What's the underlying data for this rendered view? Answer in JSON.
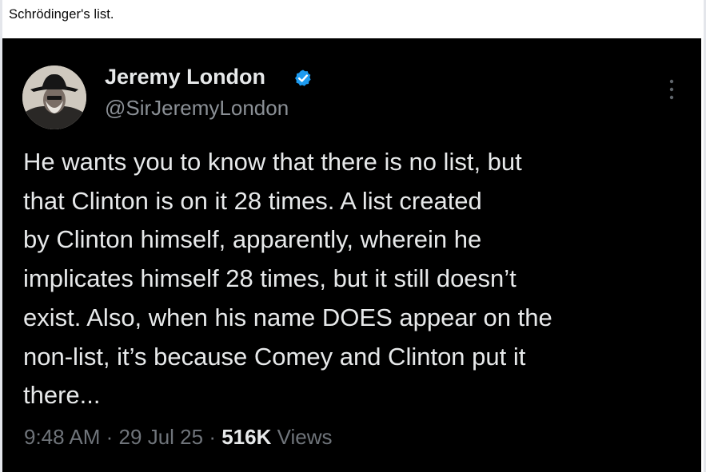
{
  "post": {
    "caption": "Schrödinger's list."
  },
  "tweet": {
    "author_name": "Jeremy London",
    "handle": "@SirJeremyLondon",
    "verified": true,
    "verified_color": "#1d9bf0",
    "icons": [
      "avatar",
      "verified-badge-icon",
      "more-options-icon"
    ],
    "body_lines": [
      "He wants you to know that there is no list, but",
      "that Clinton is on it 28 times. A list created",
      "by Clinton himself, apparently, wherein he",
      "implicates himself 28 times, but it still doesn’t",
      "exist. Also, when his name DOES appear on the",
      "non-list, it’s because Comey and Clinton put it",
      "there..."
    ],
    "time": "9:48 AM",
    "separator": "·",
    "date": "29 Jul 25",
    "views_count": "516K",
    "views_label": "Views"
  }
}
